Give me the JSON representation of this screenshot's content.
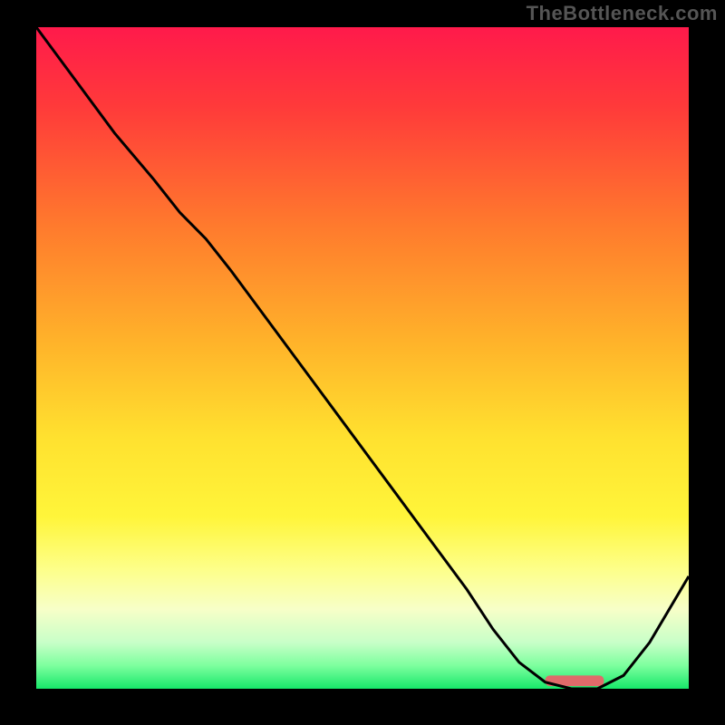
{
  "watermark": "TheBottleneck.com",
  "chart_data": {
    "type": "line",
    "title": "",
    "xlabel": "",
    "ylabel": "",
    "xlim": [
      0,
      100
    ],
    "ylim": [
      0,
      100
    ],
    "grid": false,
    "legend": false,
    "gradient_stops": [
      {
        "offset": 0.0,
        "color": "#ff1a4b"
      },
      {
        "offset": 0.12,
        "color": "#ff3a3a"
      },
      {
        "offset": 0.3,
        "color": "#ff7a2d"
      },
      {
        "offset": 0.48,
        "color": "#ffb42a"
      },
      {
        "offset": 0.62,
        "color": "#ffe12f"
      },
      {
        "offset": 0.74,
        "color": "#fff53a"
      },
      {
        "offset": 0.82,
        "color": "#fdff8a"
      },
      {
        "offset": 0.88,
        "color": "#f7ffc8"
      },
      {
        "offset": 0.93,
        "color": "#c8ffc8"
      },
      {
        "offset": 0.965,
        "color": "#7dff9e"
      },
      {
        "offset": 1.0,
        "color": "#17e86a"
      }
    ],
    "series": [
      {
        "name": "bottleneck-curve",
        "color": "#000000",
        "x": [
          0,
          6,
          12,
          18,
          22,
          26,
          30,
          36,
          42,
          48,
          54,
          60,
          66,
          70,
          74,
          78,
          82,
          86,
          90,
          94,
          100
        ],
        "y": [
          100,
          92,
          84,
          77,
          72,
          68,
          63,
          55,
          47,
          39,
          31,
          23,
          15,
          9,
          4,
          1,
          0,
          0,
          2,
          7,
          17
        ]
      }
    ],
    "marker": {
      "name": "optimal-range",
      "color": "#e06a6a",
      "x_start": 78,
      "x_end": 87,
      "y": 1.2,
      "thickness_pct": 1.6
    }
  }
}
